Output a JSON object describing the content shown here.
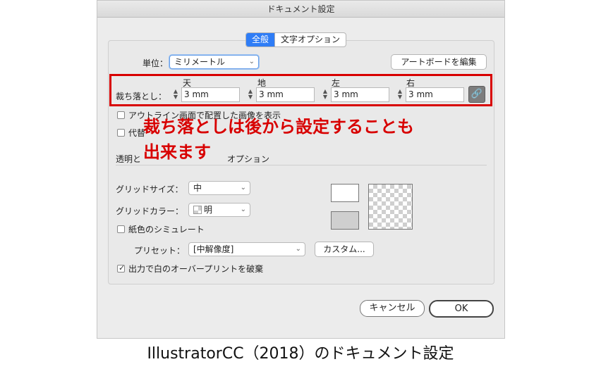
{
  "window": {
    "title": "ドキュメント設定"
  },
  "tabs": [
    {
      "label": "全般",
      "active": true
    },
    {
      "label": "文字オプション",
      "active": false
    }
  ],
  "general": {
    "unit_label": "単位：",
    "unit_value": "ミリメートル",
    "artboard_button": "アートボードを編集",
    "bleed_label": "裁ち落とし：",
    "bleed": [
      {
        "header": "天",
        "value": "3 mm"
      },
      {
        "header": "地",
        "value": "3 mm"
      },
      {
        "header": "左",
        "value": "3 mm"
      },
      {
        "header": "右",
        "value": "3 mm"
      }
    ],
    "outline_checkbox": "アウトライン画面で配置した画像を表示",
    "alt_checkbox_prefix": "代替"
  },
  "annotation": {
    "line1": "裁ち落としは後から設定することも",
    "line2": "出来ます",
    "color": "#d80000"
  },
  "transparency": {
    "section_title_prefix": "透明と",
    "section_title_suffix": "オプション",
    "grid_size_label": "グリッドサイズ：",
    "grid_size_value": "中",
    "grid_color_label": "グリッドカラー：",
    "grid_color_value": "明",
    "simulate_paper": "紙色のシミュレート",
    "preset_label": "プリセット：",
    "preset_value": "[中解像度]",
    "custom_button": "カスタム...",
    "overprint_checkbox": "出力で白のオーバープリントを破棄",
    "overprint_checked": true
  },
  "buttons": {
    "cancel": "キャンセル",
    "ok": "OK"
  },
  "caption": "IllustratorCC（2018）のドキュメント設定"
}
